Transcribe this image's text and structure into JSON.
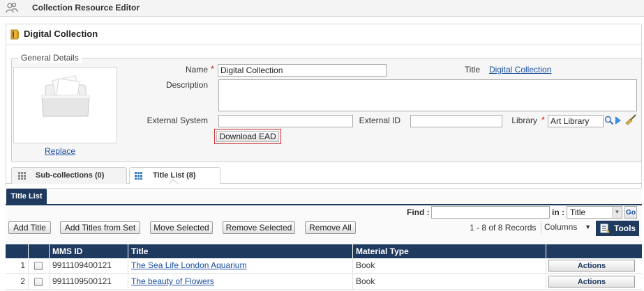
{
  "app": {
    "title": "Collection Resource Editor"
  },
  "page": {
    "title": "Digital Collection"
  },
  "general": {
    "legend": "General Details",
    "replace_label": "Replace",
    "name_label": "Name",
    "name_value": "Digital Collection",
    "title_label": "Title",
    "title_value": "Digital Collection",
    "description_label": "Description",
    "description_value": "",
    "external_system_label": "External System",
    "external_system_value": "",
    "external_id_label": "External ID",
    "external_id_value": "",
    "library_label": "Library",
    "library_value": "Art Library",
    "required_mark": "*",
    "download_label": "Download EAD"
  },
  "tabs": [
    {
      "label": "Sub-collections (0)",
      "active": false
    },
    {
      "label": "Title List (8)",
      "active": true
    }
  ],
  "title_list": {
    "subtab_label": "Title List",
    "find_label": "Find :",
    "find_value": "",
    "in_label": "in :",
    "in_value": "Title",
    "go_label": "Go",
    "buttons": {
      "add_title": "Add Title",
      "add_titles_from_set": "Add Titles from Set",
      "move_selected": "Move Selected",
      "remove_selected": "Remove Selected",
      "remove_all": "Remove All"
    },
    "records": "1 - 8 of 8 Records",
    "columns_label": "Columns",
    "tools_label": "Tools",
    "headers": {
      "mms_id": "MMS ID",
      "title": "Title",
      "material_type": "Material Type"
    },
    "rows": [
      {
        "num": "1",
        "mms_id": "9911109400121",
        "title": "The Sea Life London Aquarium",
        "material_type": "Book",
        "action": "Actions"
      },
      {
        "num": "2",
        "mms_id": "9911109500121",
        "title": "The beauty of Flowers",
        "material_type": "Book",
        "action": "Actions"
      }
    ]
  },
  "colors": {
    "accent": "#1f3a5f",
    "link": "#1b4fa0",
    "required": "#cc0000"
  }
}
